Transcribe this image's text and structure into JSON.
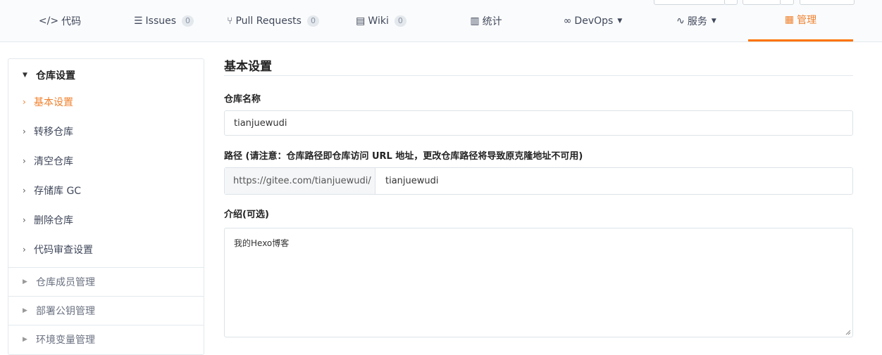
{
  "tabs": [
    {
      "icon": "code-icon",
      "glyph": "</>",
      "label": "代码",
      "count": "",
      "caret": false,
      "active": false
    },
    {
      "icon": "issues-icon",
      "glyph": "☰",
      "label": "Issues",
      "count": "0",
      "caret": false,
      "active": false
    },
    {
      "icon": "pull-request-icon",
      "glyph": "⑂",
      "label": "Pull Requests",
      "count": "0",
      "caret": false,
      "active": false
    },
    {
      "icon": "wiki-icon",
      "glyph": "▤",
      "label": "Wiki",
      "count": "0",
      "caret": false,
      "active": false
    },
    {
      "icon": "stats-icon",
      "glyph": "▥",
      "label": "统计",
      "count": "",
      "caret": false,
      "active": false
    },
    {
      "icon": "devops-icon",
      "glyph": "∞",
      "label": "DevOps",
      "count": "",
      "caret": true,
      "active": false
    },
    {
      "icon": "service-icon",
      "glyph": "∿",
      "label": "服务",
      "count": "",
      "caret": true,
      "active": false
    },
    {
      "icon": "manage-icon",
      "glyph": "▦",
      "label": "管理",
      "count": "",
      "caret": false,
      "active": true
    }
  ],
  "sidebar": {
    "section_title": "仓库设置",
    "items": [
      {
        "label": "基本设置",
        "active": true
      },
      {
        "label": "转移仓库",
        "active": false
      },
      {
        "label": "清空仓库",
        "active": false
      },
      {
        "label": "存储库 GC",
        "active": false
      },
      {
        "label": "删除仓库",
        "active": false
      },
      {
        "label": "代码审查设置",
        "active": false
      }
    ],
    "groups": [
      {
        "label": "仓库成员管理"
      },
      {
        "label": "部署公钥管理"
      },
      {
        "label": "环境变量管理"
      }
    ]
  },
  "main": {
    "title": "基本设置",
    "repo_name_label": "仓库名称",
    "repo_name_value": "tianjuewudi",
    "path_label": "路径 (请注意：仓库路径即仓库访问 URL 地址，更改仓库路径将导致原克隆地址不可用)",
    "path_prefix": "https://gitee.com/tianjuewudi/",
    "path_value": "tianjuewudi",
    "intro_label": "介绍(可选)",
    "intro_value": "我的Hexo博客"
  },
  "colors": {
    "accent": "#f0802c",
    "border": "#e3e9ed"
  }
}
